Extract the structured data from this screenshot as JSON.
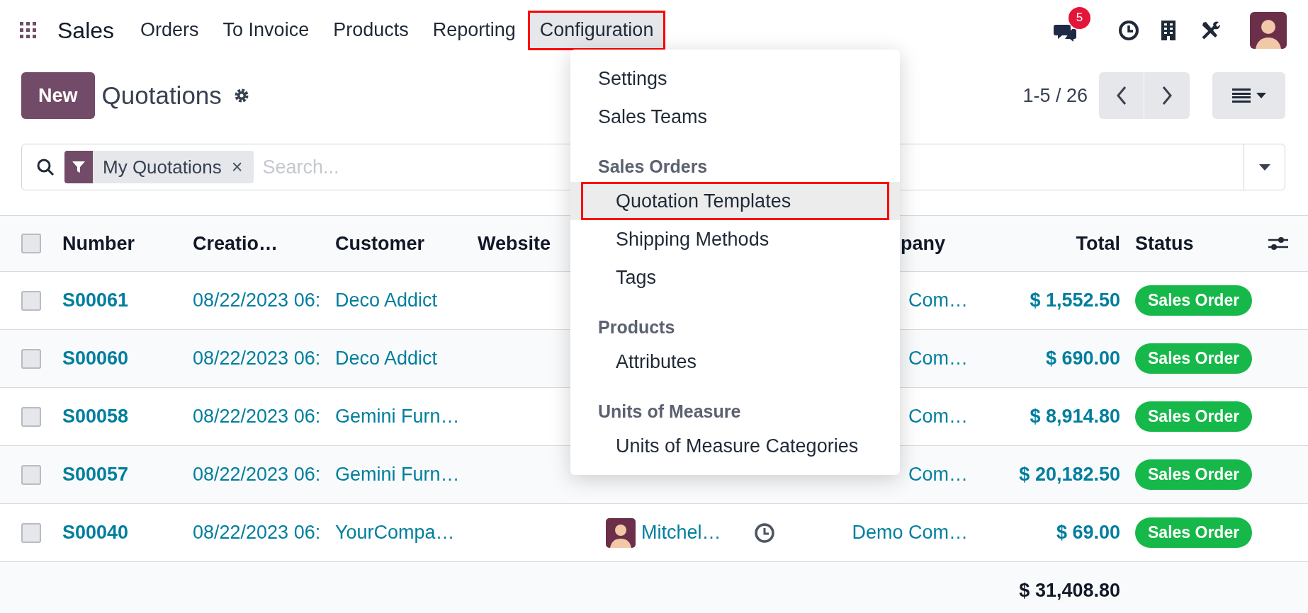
{
  "navbar": {
    "app": "Sales",
    "menu": [
      {
        "label": "Orders",
        "selected": false,
        "outlined": false
      },
      {
        "label": "To Invoice",
        "selected": false,
        "outlined": false
      },
      {
        "label": "Products",
        "selected": false,
        "outlined": false
      },
      {
        "label": "Reporting",
        "selected": false,
        "outlined": false
      },
      {
        "label": "Configuration",
        "selected": true,
        "outlined": true
      }
    ],
    "chat_badge": "5"
  },
  "control_panel": {
    "new_button": "New",
    "title": "Quotations",
    "pager": "1-5 / 26"
  },
  "search": {
    "facet": "My Quotations",
    "facet_remove": "×",
    "placeholder": "Search..."
  },
  "table": {
    "select_all": {
      "checked": false
    },
    "columns": [
      "Number",
      "Creatio…",
      "Customer",
      "Website",
      "pany",
      "Total",
      "Status"
    ],
    "rows": [
      {
        "checked": false,
        "number": "S00061",
        "creation": "08/22/2023 06:",
        "customer": "Deco Addict",
        "company": "Com…",
        "total": "$ 1,552.50",
        "status": "Sales Order"
      },
      {
        "checked": false,
        "number": "S00060",
        "creation": "08/22/2023 06:",
        "customer": "Deco Addict",
        "company": "Com…",
        "total": "$ 690.00",
        "status": "Sales Order"
      },
      {
        "checked": false,
        "number": "S00058",
        "creation": "08/22/2023 06:",
        "customer": "Gemini Furn…",
        "company": "Com…",
        "total": "$ 8,914.80",
        "status": "Sales Order"
      },
      {
        "checked": false,
        "number": "S00057",
        "creation": "08/22/2023 06:",
        "customer": "Gemini Furn…",
        "company": "Com…",
        "total": "$ 20,182.50",
        "status": "Sales Order"
      },
      {
        "checked": false,
        "number": "S00040",
        "creation": "08/22/2023 06:",
        "customer": "YourCompa…",
        "salesperson": "Mitchel…",
        "activity": true,
        "company": "Demo Com…",
        "total": "$ 69.00",
        "status": "Sales Order"
      }
    ],
    "footer_total": "$ 31,408.80"
  },
  "dropdown": {
    "entries": [
      {
        "kind": "item",
        "label": "Settings",
        "outlined": false,
        "selected": false
      },
      {
        "kind": "item",
        "label": "Sales Teams",
        "outlined": false,
        "selected": false
      },
      {
        "kind": "section",
        "label": "Sales Orders",
        "children": [
          {
            "label": "Quotation Templates",
            "outlined": true,
            "selected": true
          },
          {
            "label": "Shipping Methods",
            "outlined": false,
            "selected": false
          },
          {
            "label": "Tags",
            "outlined": false,
            "selected": false
          }
        ]
      },
      {
        "kind": "section",
        "label": "Products",
        "children": [
          {
            "label": "Attributes",
            "outlined": false,
            "selected": false
          }
        ]
      },
      {
        "kind": "section",
        "label": "Units of Measure",
        "children": [
          {
            "label": "Units of Measure Categories",
            "outlined": false,
            "selected": false
          }
        ]
      }
    ]
  }
}
